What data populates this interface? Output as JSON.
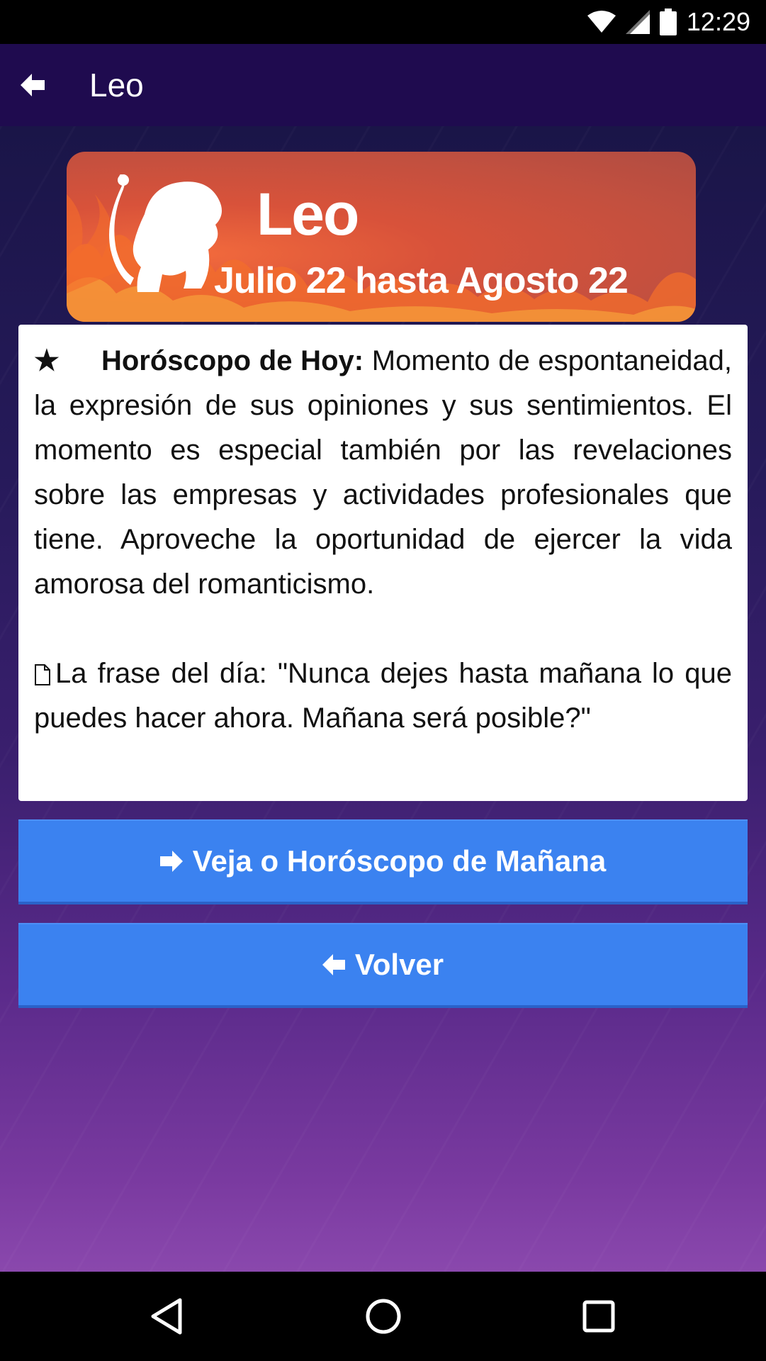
{
  "status_bar": {
    "time": "12:29",
    "icons": [
      "wifi-icon",
      "signal-icon",
      "battery-icon"
    ]
  },
  "app_bar": {
    "title": "Leo",
    "back_icon": "arrow-left-icon"
  },
  "banner": {
    "sign_name": "Leo",
    "dates": "Julio 22 hasta Agosto 22",
    "icon": "lion-icon"
  },
  "horoscope": {
    "star": "★",
    "heading": "Horóscopo de Hoy:",
    "text": "Momento de espontaneidad, la expresión de sus opiniones y sus sentimientos. El momento es especial también por las revelaciones sobre las empresas y actividades profesionales que tiene. Aproveche la oportunidad de ejercer la vida amorosa del romanticismo.",
    "phrase": "La frase del día: \"Nunca dejes hasta mañana lo que puedes hacer ahora. Mañana será posible?\""
  },
  "buttons": {
    "next_label": "Veja o Horóscopo de Mañana",
    "back_label": "Volver"
  },
  "colors": {
    "app_bar": "#1f0b4f",
    "button": "#3b82f0",
    "banner": "#d8523a"
  },
  "nav_bar": {
    "icons": [
      "nav-back-icon",
      "nav-home-icon",
      "nav-recent-icon"
    ]
  }
}
